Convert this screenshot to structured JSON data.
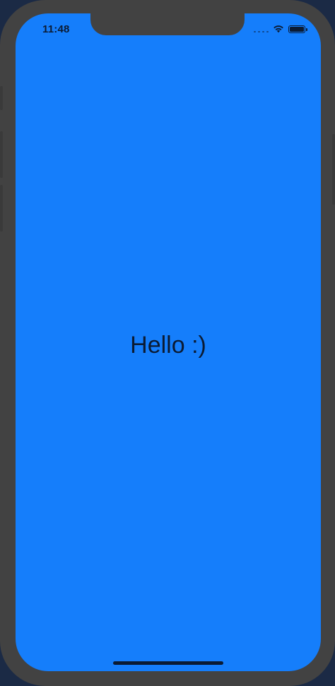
{
  "status_bar": {
    "time": "11:48",
    "icons": [
      "signal-dots-icon",
      "wifi-icon",
      "battery-icon"
    ]
  },
  "content": {
    "greeting": "Hello :)"
  },
  "colors": {
    "screen_background": "#157efb",
    "frame": "#424242",
    "text": "#0b1b33"
  }
}
